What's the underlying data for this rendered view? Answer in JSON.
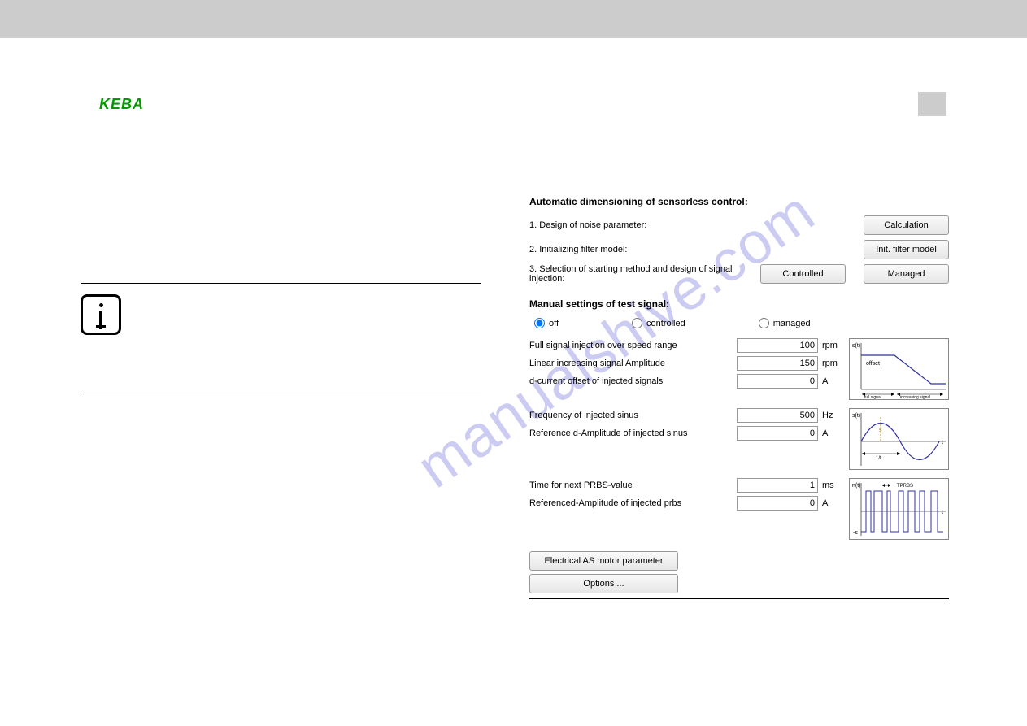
{
  "logo": "KEBA",
  "watermark": "manualshive.com",
  "sections": {
    "auto_title": "Automatic dimensioning of sensorless control:",
    "step1": "1. Design of noise parameter:",
    "step2": "2. Initializing filter model:",
    "step3": "3. Selection of starting method and design of signal injection:",
    "manual_title": "Manual settings of test signal:"
  },
  "buttons": {
    "calculation": "Calculation",
    "init_filter": "Init. filter model",
    "controlled": "Controlled",
    "managed": "Managed",
    "electrical": "Electrical AS motor parameter",
    "options": "Options ..."
  },
  "radios": {
    "off": "off",
    "controlled": "controlled",
    "managed": "managed",
    "selected": "off"
  },
  "params": {
    "full_signal": {
      "label": "Full signal injection over speed range",
      "value": "100",
      "unit": "rpm"
    },
    "linear_amp": {
      "label": "Linear increasing signal Amplitude",
      "value": "150",
      "unit": "rpm"
    },
    "d_offset": {
      "label": "d-current offset of injected signals",
      "value": "0",
      "unit": "A"
    },
    "freq_sinus": {
      "label": "Frequency of injected sinus",
      "value": "500",
      "unit": "Hz"
    },
    "ref_d_amp": {
      "label": "Reference d-Amplitude of injected sinus",
      "value": "0",
      "unit": "A"
    },
    "prbs_time": {
      "label": "Time for next PRBS-value",
      "value": "1",
      "unit": "ms"
    },
    "prbs_amp": {
      "label": "Referenced-Amplitude of injected prbs",
      "value": "0",
      "unit": "A"
    }
  },
  "diagrams": {
    "d1_text1": "offset",
    "d1_text2": "full signal",
    "d1_text3": "increasing signal",
    "d2_ax": "s(t)",
    "d2_t": "t",
    "d2_period": "1/f",
    "d3_ax": "n(t)",
    "d3_label": "TPRBS",
    "d3_t": "t",
    "d3_neg": "-s"
  }
}
